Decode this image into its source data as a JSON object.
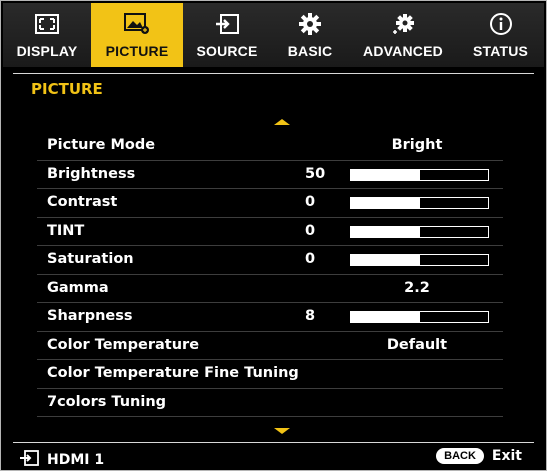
{
  "tabs": [
    {
      "label": "DISPLAY",
      "icon": "display-icon",
      "active": false
    },
    {
      "label": "PICTURE",
      "icon": "picture-icon",
      "active": true
    },
    {
      "label": "SOURCE",
      "icon": "source-icon",
      "active": false
    },
    {
      "label": "BASIC",
      "icon": "gear-icon",
      "active": false
    },
    {
      "label": "ADVANCED",
      "icon": "advanced-gear-icon",
      "active": false
    },
    {
      "label": "STATUS",
      "icon": "info-icon",
      "active": false
    }
  ],
  "section_title": "PICTURE",
  "rows": [
    {
      "label": "Picture Mode",
      "value": "Bright"
    },
    {
      "label": "Brightness",
      "value": "50",
      "bar_fraction": 0.5
    },
    {
      "label": "Contrast",
      "value": "0",
      "bar_fraction": 0.5
    },
    {
      "label": "TINT",
      "value": "0",
      "bar_fraction": 0.5
    },
    {
      "label": "Saturation",
      "value": "0",
      "bar_fraction": 0.5
    },
    {
      "label": "Gamma",
      "value": "2.2"
    },
    {
      "label": "Sharpness",
      "value": "8",
      "bar_fraction": 0.5
    },
    {
      "label": "Color Temperature",
      "value": "Default"
    },
    {
      "label": "Color Temperature Fine Tuning",
      "value": ""
    },
    {
      "label": "7colors Tuning",
      "value": ""
    }
  ],
  "footer": {
    "source_label": "HDMI 1",
    "back_label": "BACK",
    "exit_label": "Exit"
  },
  "colors": {
    "accent": "#f2c316",
    "background": "#000000",
    "text": "#ffffff"
  }
}
